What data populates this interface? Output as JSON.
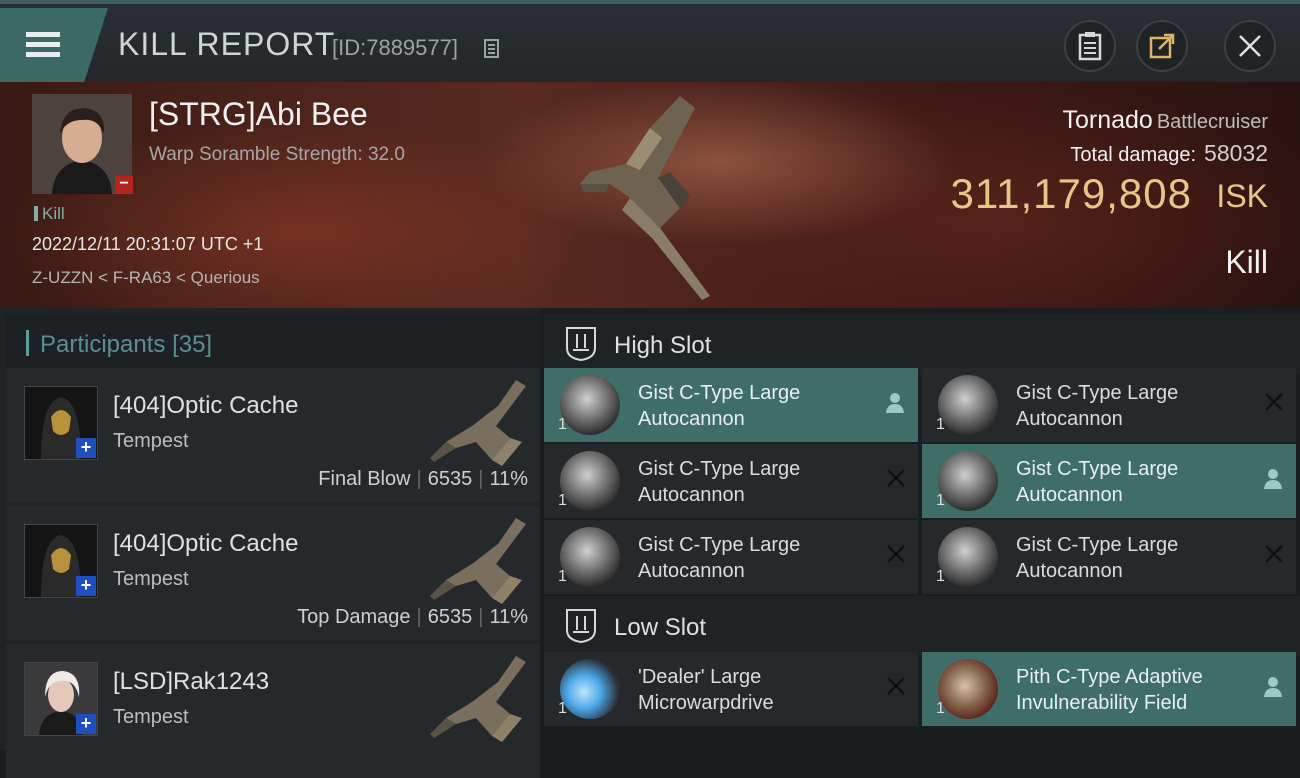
{
  "header": {
    "title": "KILL REPORT",
    "report_id": "[ID:7889577]"
  },
  "victim": {
    "name": "[STRG]Abi Bee",
    "scramble": "Warp Soramble Strength: 32.0",
    "kill_tag": "Kill",
    "datetime": "2022/12/11 20:31:07 UTC +1",
    "location": "Z-UZZN < F-RA63 < Querious",
    "ship_name": "Tornado",
    "ship_class": "Battlecruiser",
    "damage_label": "Total damage:",
    "damage_value": "58032",
    "isk_value": "311,179,808",
    "isk_unit": "ISK",
    "result": "Kill"
  },
  "participants": {
    "title": "Participants",
    "count": "[35]",
    "rows": [
      {
        "name": "[404]Optic Cache",
        "ship": "Tempest",
        "tag": "Final Blow",
        "damage": "6535",
        "percent": "11%"
      },
      {
        "name": "[404]Optic Cache",
        "ship": "Tempest",
        "tag": "Top Damage",
        "damage": "6535",
        "percent": "11%"
      },
      {
        "name": "[LSD]Rak1243",
        "ship": "Tempest",
        "tag": "",
        "damage": "",
        "percent": ""
      }
    ]
  },
  "high_slot": {
    "title": "High Slot",
    "items": [
      {
        "line1": "Gist C-Type Large",
        "line2": "Autocannon",
        "qty": "1",
        "state": "dropped"
      },
      {
        "line1": "Gist C-Type Large",
        "line2": "Autocannon",
        "qty": "1",
        "state": "destroyed"
      },
      {
        "line1": "Gist C-Type Large",
        "line2": "Autocannon",
        "qty": "1",
        "state": "destroyed"
      },
      {
        "line1": "Gist C-Type Large",
        "line2": "Autocannon",
        "qty": "1",
        "state": "dropped"
      },
      {
        "line1": "Gist C-Type Large",
        "line2": "Autocannon",
        "qty": "1",
        "state": "destroyed"
      },
      {
        "line1": "Gist C-Type Large",
        "line2": "Autocannon",
        "qty": "1",
        "state": "destroyed"
      }
    ]
  },
  "low_slot": {
    "title": "Low Slot",
    "items": [
      {
        "line1": "'Dealer' Large",
        "line2": "Microwarpdrive",
        "qty": "1",
        "state": "destroyed"
      },
      {
        "line1": "Pith C-Type Adaptive",
        "line2": "Invulnerability Field",
        "qty": "1",
        "state": "dropped"
      }
    ]
  },
  "colors": {
    "accent": "#3f6e68",
    "isk": "#e6c78a",
    "badge_red": "#b3261e",
    "badge_blue": "#1f4fbf"
  }
}
